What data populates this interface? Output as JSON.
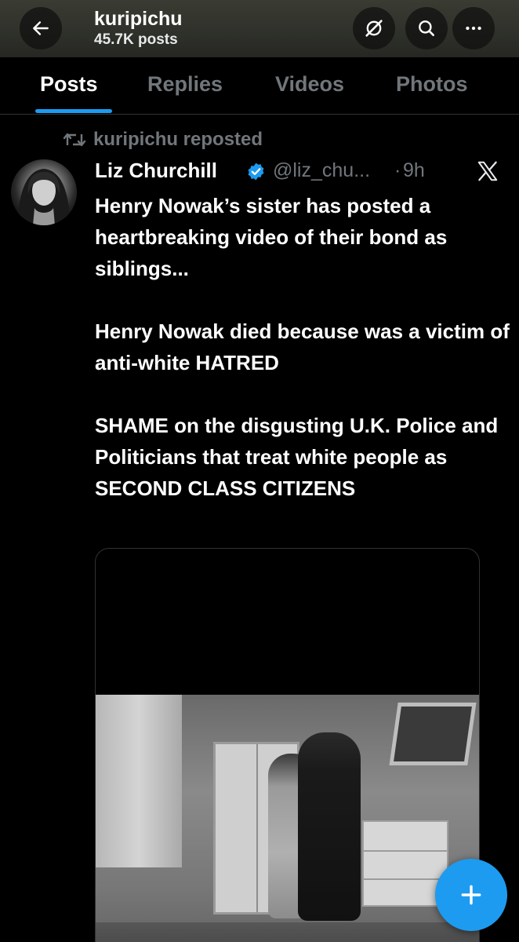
{
  "header": {
    "back_icon": "arrow-left-icon",
    "profile_name": "kuripichu",
    "post_count": "45.7K posts",
    "grok_icon": "grok-slash-circle-icon",
    "search_icon": "search-icon",
    "more_icon": "more-horizontal-icon"
  },
  "tabs": [
    {
      "label": "Posts",
      "active": true
    },
    {
      "label": "Replies",
      "active": false
    },
    {
      "label": "Videos",
      "active": false
    },
    {
      "label": "Photos",
      "active": false
    }
  ],
  "post": {
    "repost_label": "kuripichu reposted",
    "author_name": "Liz Churchill",
    "verified": true,
    "handle": "@liz_chu...",
    "separator": "·",
    "time": "9h",
    "paragraphs": [
      "Henry Nowak’s sister has posted a heartbreaking video of their bond as siblings...",
      "Henry Nowak died because was a victim of anti-white HATRED",
      "SHAME on the disgusting U.K. Police and Politicians that treat white people as SECOND CLASS CITIZENS"
    ]
  },
  "fab": {
    "icon": "plus-icon"
  },
  "colors": {
    "accent": "#1d9bf0",
    "background": "#000000",
    "secondary_text": "#71767b",
    "primary_text": "#ffffff"
  }
}
